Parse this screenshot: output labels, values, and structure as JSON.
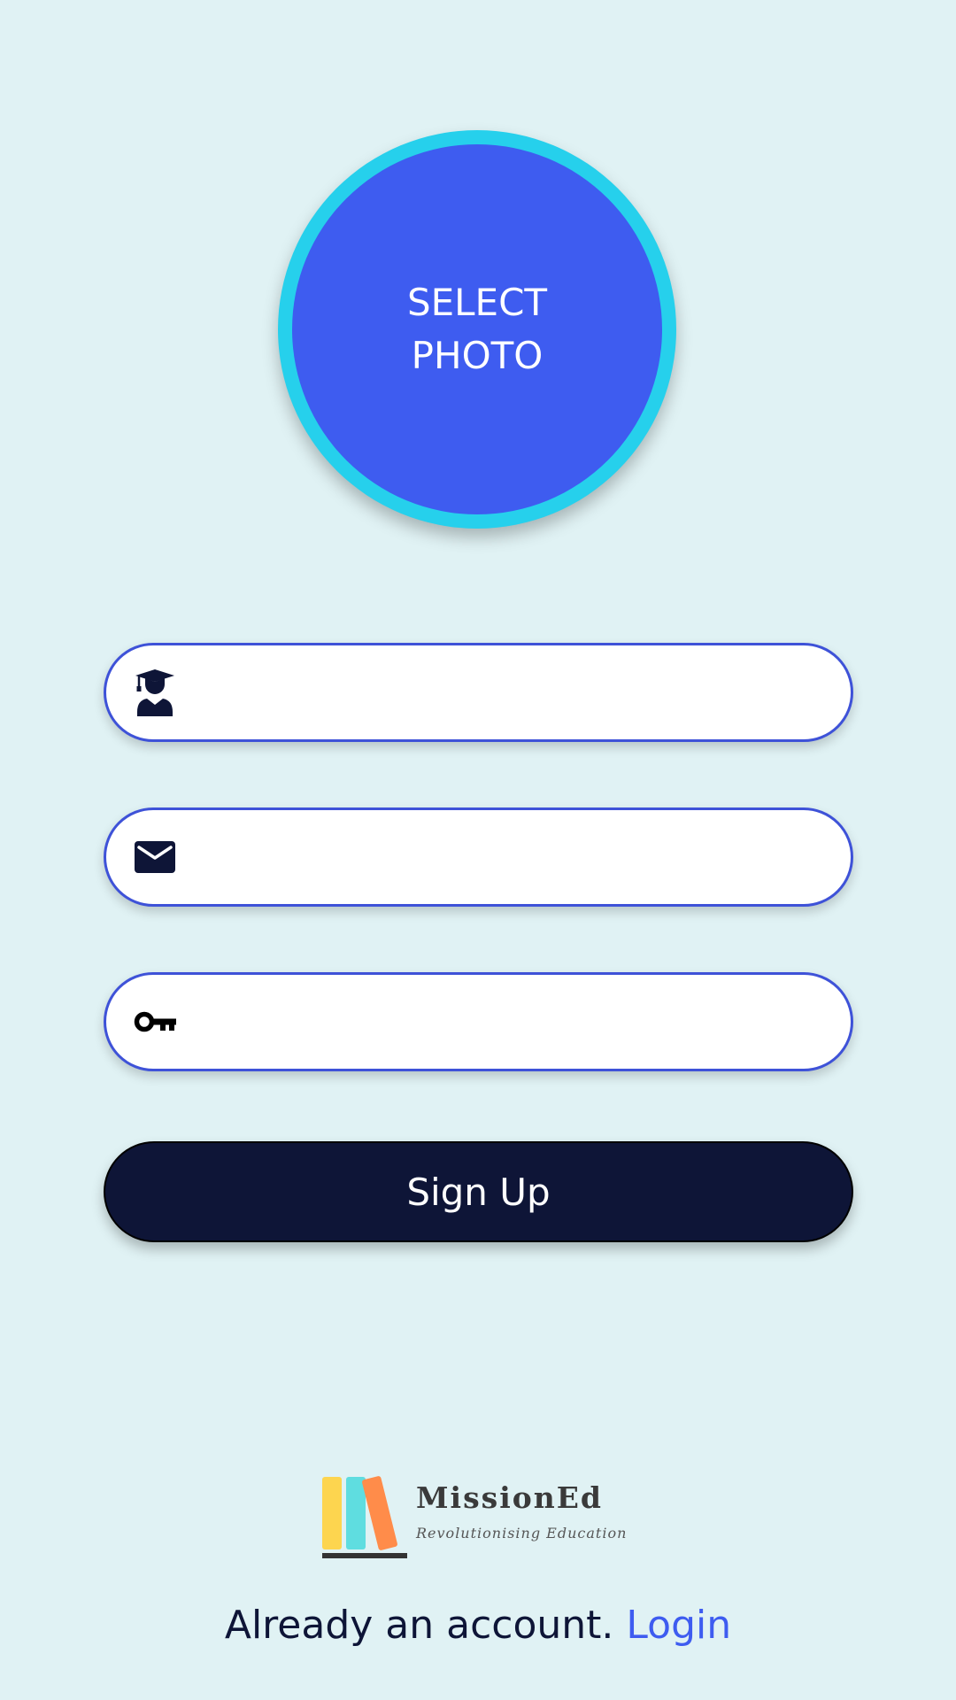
{
  "photo": {
    "label_line1": "SELECT",
    "label_line2": "PHOTO"
  },
  "form": {
    "name_field": {
      "icon": "student-graduate-icon",
      "value": "",
      "placeholder": ""
    },
    "email_field": {
      "icon": "mail-icon",
      "value": "",
      "placeholder": ""
    },
    "password_field": {
      "icon": "key-icon",
      "value": "",
      "placeholder": ""
    },
    "signup_label": "Sign Up"
  },
  "brand": {
    "name": "MissionEd",
    "tagline": "Revolutionising Education"
  },
  "footer": {
    "prompt": "Already an account.",
    "login_label": "Login"
  },
  "colors": {
    "background": "#e0f2f4",
    "accent": "#3e5cf0",
    "ring": "#26d0ec",
    "dark": "#0e1537",
    "field_border": "#3e52d8"
  }
}
